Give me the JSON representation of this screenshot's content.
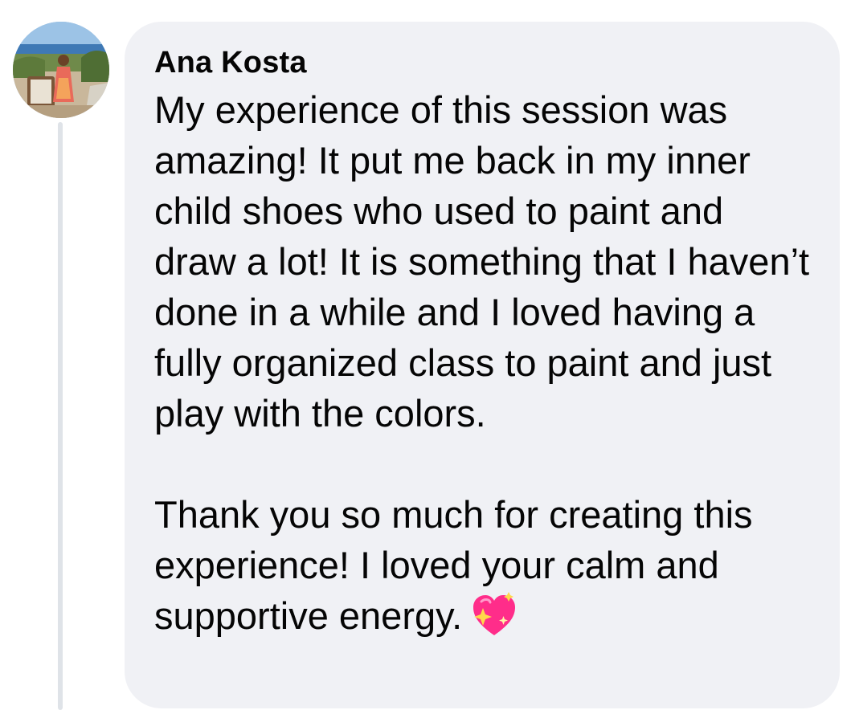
{
  "comment": {
    "author": "Ana Kosta",
    "paragraphs": [
      "My experience of this session was amazing! It put me back in my inner child shoes who used to paint and draw a lot! It is something that I haven’t done in a while and I loved having a fully organized class to paint and just play with the colors.",
      "Thank you so much for creating this experience! I loved your calm and supportive energy."
    ],
    "emoji": "sparkling-heart-icon"
  },
  "colors": {
    "bubble_background": "#f0f1f5",
    "text": "#050505",
    "thread_line": "#dfe3e8",
    "heart": "#ff2d8a"
  }
}
